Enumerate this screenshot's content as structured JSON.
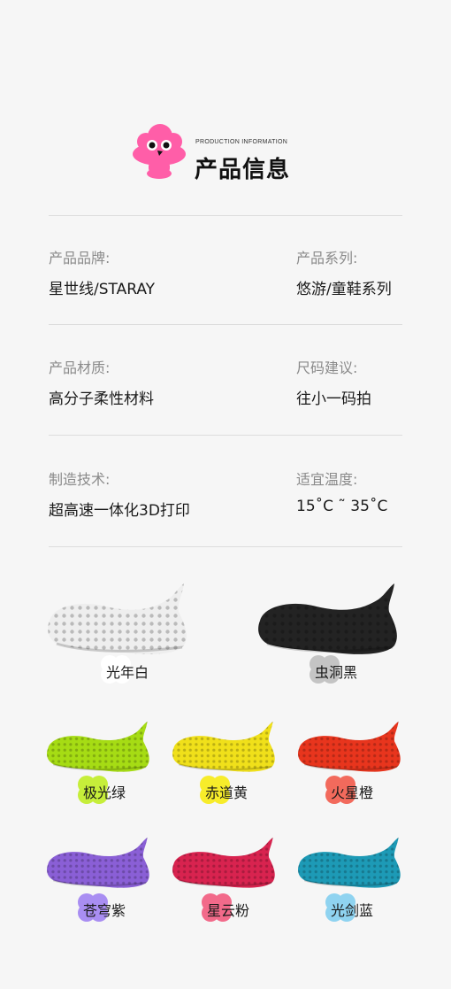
{
  "header": {
    "subtitle": "PRODUCTION INFORMATION",
    "title": "产品信息",
    "logo_color": "#ff5ea8"
  },
  "info": [
    {
      "label": "产品品牌:",
      "value": "星世线/STARAY"
    },
    {
      "label": "产品系列:",
      "value": "悠游/童鞋系列"
    },
    {
      "label": "产品材质:",
      "value": "高分子柔性材料"
    },
    {
      "label": "尺码建议:",
      "value": "往小一码拍"
    },
    {
      "label": "制造技术:",
      "value": "超高速一体化3D打印"
    },
    {
      "label": "适宜温度:",
      "value": "15˚C ˜ 35˚C"
    }
  ],
  "colors": [
    {
      "name": "光年白",
      "shoe_color": "#eeeeee",
      "tag_color": "#ffffff"
    },
    {
      "name": "虫洞黑",
      "shoe_color": "#232323",
      "tag_color": "#c4c4c4"
    },
    {
      "name": "极光绿",
      "shoe_color": "#a6dc14",
      "tag_color": "#c6ee3a"
    },
    {
      "name": "赤道黄",
      "shoe_color": "#f0e01a",
      "tag_color": "#f7ec2a"
    },
    {
      "name": "火星橙",
      "shoe_color": "#e8351d",
      "tag_color": "#f26a5c"
    },
    {
      "name": "苍穹紫",
      "shoe_color": "#8a5fd6",
      "tag_color": "#a98ef2"
    },
    {
      "name": "星云粉",
      "shoe_color": "#d8234f",
      "tag_color": "#f26a8a"
    },
    {
      "name": "光剑蓝",
      "shoe_color": "#1d9ab6",
      "tag_color": "#8fd3f0"
    }
  ]
}
